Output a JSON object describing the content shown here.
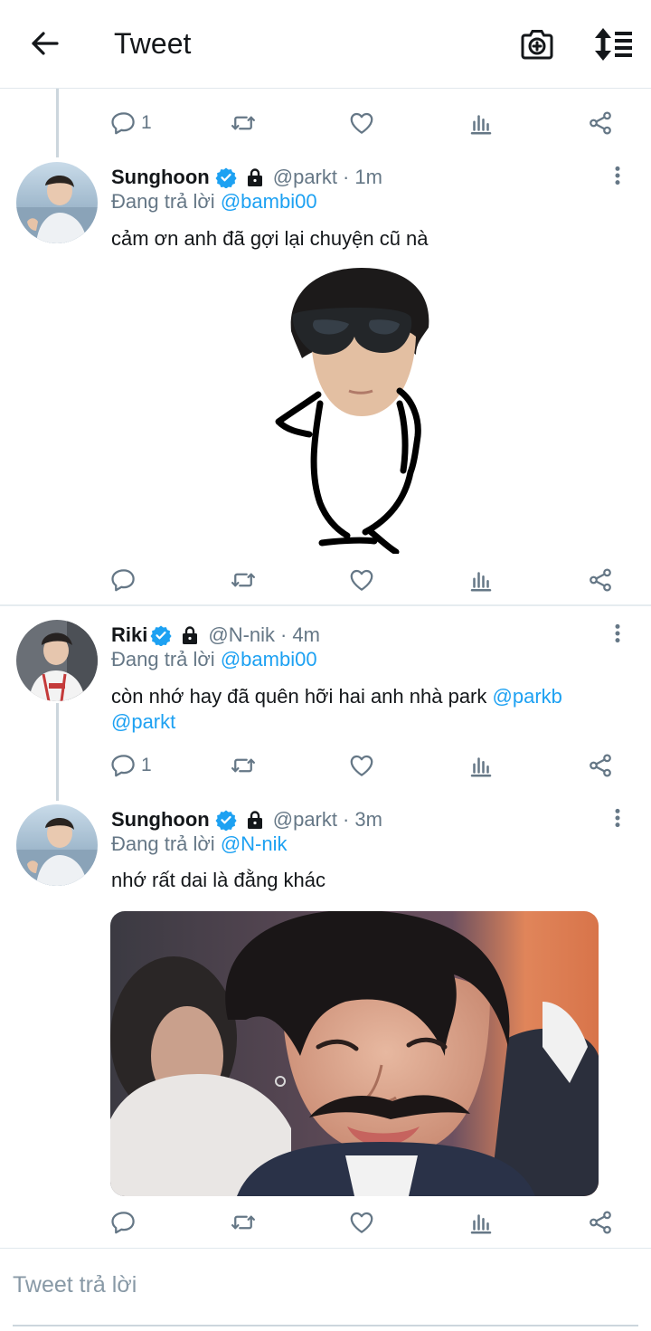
{
  "header": {
    "title": "Tweet"
  },
  "tweets": [
    {
      "reply_count": "1"
    },
    {
      "name": "Sunghoon",
      "handle": "@parkt",
      "separator": "·",
      "time": "1m",
      "reply_prefix": "Đang trả lời",
      "reply_mention": "@bambi00",
      "text": "cảm ơn anh đã gợi lại chuyện cũ nà"
    },
    {
      "name": "Riki",
      "handle": "@N-nik",
      "separator": "·",
      "time": "4m",
      "reply_prefix": "Đang trả lời",
      "reply_mention": "@bambi00",
      "text": "còn nhớ hay đã quên hỡi hai anh nhà park",
      "mention_1": "@parkb",
      "mention_2": "@parkt",
      "reply_count": "1"
    },
    {
      "name": "Sunghoon",
      "handle": "@parkt",
      "separator": "·",
      "time": "3m",
      "reply_prefix": "Đang trả lời",
      "reply_mention": "@N-nik",
      "text": "nhớ rất dai là đằng khác"
    }
  ],
  "reply_box": {
    "placeholder": "Tweet trả lời"
  },
  "colors": {
    "accent": "#1da1f2",
    "secondary_text": "#657786",
    "icon": "#657786"
  },
  "icons": [
    "back-arrow-icon",
    "camera-add-icon",
    "sort-icon",
    "reply-icon",
    "retweet-icon",
    "like-icon",
    "analytics-icon",
    "share-icon",
    "verified-icon",
    "lock-icon",
    "more-icon"
  ]
}
